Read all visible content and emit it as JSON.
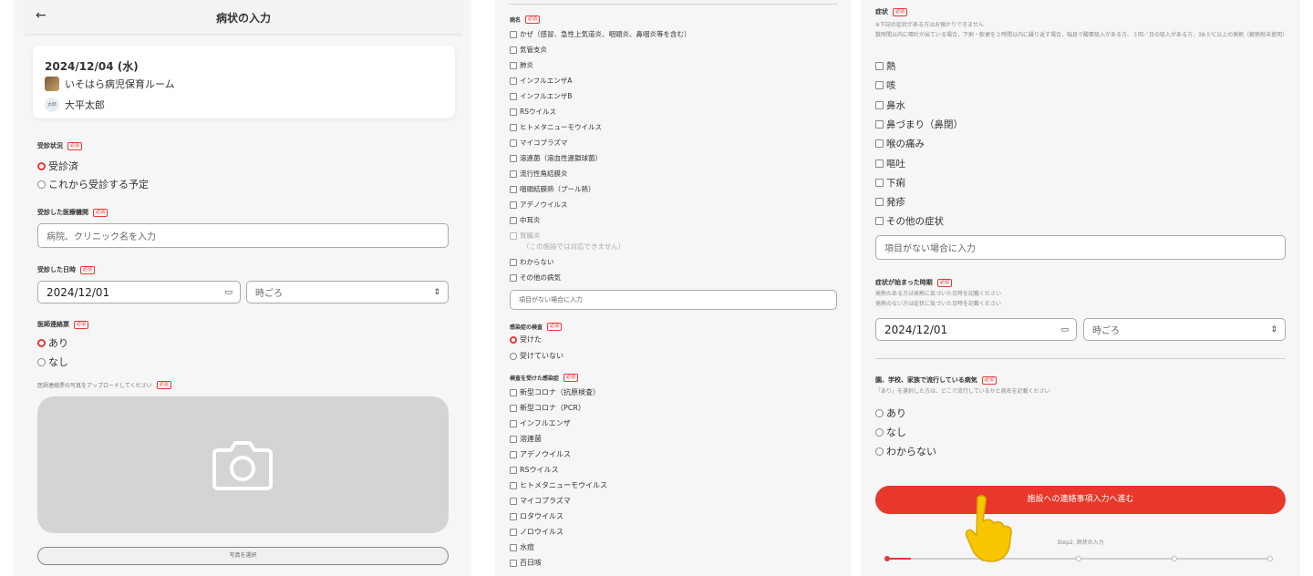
{
  "panel1": {
    "header": {
      "back": "←",
      "title": "病状の入力"
    },
    "card": {
      "date": "2024/12/04 (水)",
      "facility": "いそはら病児保育ルーム",
      "child_initials": "太郎",
      "child": "大平太郎"
    },
    "consult_status": {
      "label": "受診状況",
      "options": [
        "受診済",
        "これから受診する予定"
      ],
      "selected": 0
    },
    "hospital": {
      "label": "受診した医療機関",
      "placeholder": "病院、クリニック名を入力"
    },
    "visit_datetime": {
      "label": "受診した日時",
      "date": "2024/12/01",
      "time_placeholder": "時ごろ"
    },
    "doctor_note": {
      "label": "医師連絡票",
      "options": [
        "あり",
        "なし"
      ],
      "selected": 0
    },
    "upload": {
      "label": "医師連絡票の写真をアップロードしてください",
      "button": "写真を選択"
    }
  },
  "panel2": {
    "disease": {
      "label": "病名",
      "options": [
        "かぜ（感冒、急性上気道炎、咽頭炎、鼻咽炎等を含む）",
        "気管支炎",
        "肺炎",
        "インフルエンザA",
        "インフルエンザB",
        "RSウイルス",
        "ヒトメタニューモウイルス",
        "マイコプラズマ",
        "溶連菌（溶血性連鎖球菌）",
        "流行性角結膜炎",
        "咽頭結膜熱（プール熱）",
        "アデノウイルス",
        "中耳炎",
        "胃腸炎",
        "わからない",
        "その他の病気"
      ],
      "disabled_note": "（この施設では対応できません）",
      "other_placeholder": "項目がない場合に入力"
    },
    "test": {
      "label": "感染症の検査",
      "options": [
        "受けた",
        "受けていない"
      ],
      "selected": 0
    },
    "tested": {
      "label": "検査を受けた感染症",
      "options": [
        "新型コロナ（抗原検査）",
        "新型コロナ（PCR）",
        "インフルエンザ",
        "溶連菌",
        "アデノウイルス",
        "RSウイルス",
        "ヒトメタニューモウイルス",
        "マイコプラズマ",
        "ロタウイルス",
        "ノロウイルス",
        "水痘",
        "百日咳"
      ]
    }
  },
  "panel3": {
    "symptoms": {
      "label": "症状",
      "note1": "※下記の症状がある方はお預かりできません",
      "note2": "数時間以内に嘔吐が出ている場合、下痢・軟便を２時間以内に繰り返す場合、喘息で酸素吸入がある方、３回／日の吸入がある方、38.5℃以上の発熱（解熱剤未使用）",
      "options": [
        "熱",
        "咳",
        "鼻水",
        "鼻づまり（鼻閉）",
        "喉の痛み",
        "嘔吐",
        "下痢",
        "発疹",
        "その他の症状"
      ],
      "other_placeholder": "項目がない場合に入力"
    },
    "onset": {
      "label": "症状が始まった時期",
      "note1": "発熱のある方は発熱に気づいた日時を記載ください",
      "note2": "発熱のない方は症状に気づいた日時を記載ください",
      "date": "2024/12/01",
      "time_placeholder": "時ごろ"
    },
    "epidemic": {
      "label": "園、学校、家族で流行している病気",
      "note": "「あり」を選択した方は、どこで流行しているかと病名を記載ください",
      "options": [
        "あり",
        "なし",
        "わからない"
      ]
    },
    "cta": "施設への連絡事項入力へ進む",
    "step": "Step2. 病状の入力",
    "progress": {
      "current": 1,
      "total": 5
    },
    "colors": {
      "accent": "#e8382b"
    }
  }
}
